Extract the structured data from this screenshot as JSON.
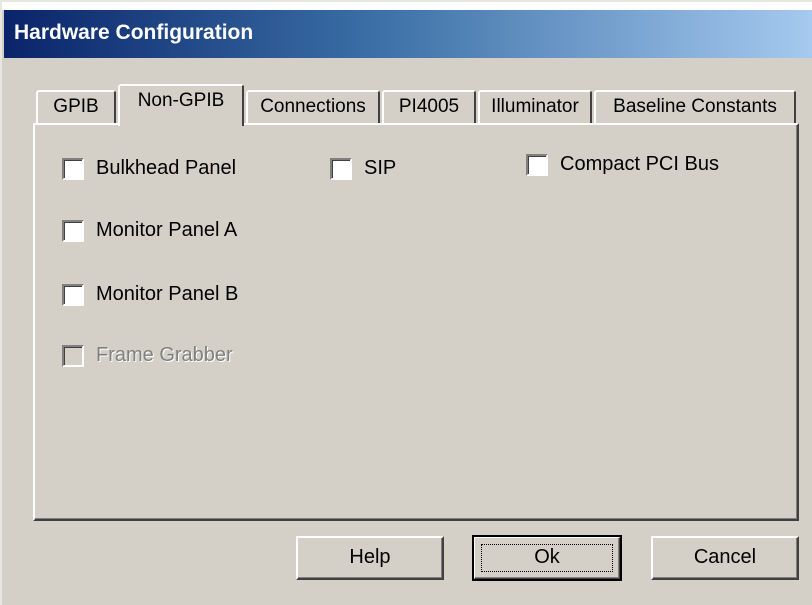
{
  "window": {
    "title": "Hardware Configuration"
  },
  "tabs": [
    {
      "label": "GPIB",
      "active": false
    },
    {
      "label": "Non-GPIB",
      "active": true
    },
    {
      "label": "Connections",
      "active": false
    },
    {
      "label": "PI4005",
      "active": false
    },
    {
      "label": "Illuminator",
      "active": false
    },
    {
      "label": "Baseline Constants",
      "active": false
    }
  ],
  "checkboxes": {
    "bulkhead_panel": {
      "label": "Bulkhead Panel",
      "checked": false,
      "enabled": true
    },
    "monitor_panel_a": {
      "label": "Monitor Panel A",
      "checked": false,
      "enabled": true
    },
    "monitor_panel_b": {
      "label": "Monitor Panel B",
      "checked": false,
      "enabled": true
    },
    "frame_grabber": {
      "label": "Frame Grabber",
      "checked": false,
      "enabled": false
    },
    "sip": {
      "label": "SIP",
      "checked": false,
      "enabled": true
    },
    "compact_pci_bus": {
      "label": "Compact PCI Bus",
      "checked": false,
      "enabled": true
    }
  },
  "buttons": {
    "help": "Help",
    "ok": "Ok",
    "cancel": "Cancel"
  },
  "colors": {
    "face": "#d4d0c8",
    "title_start": "#0a246a",
    "title_end": "#a6caf0",
    "disabled_text": "#808080"
  }
}
